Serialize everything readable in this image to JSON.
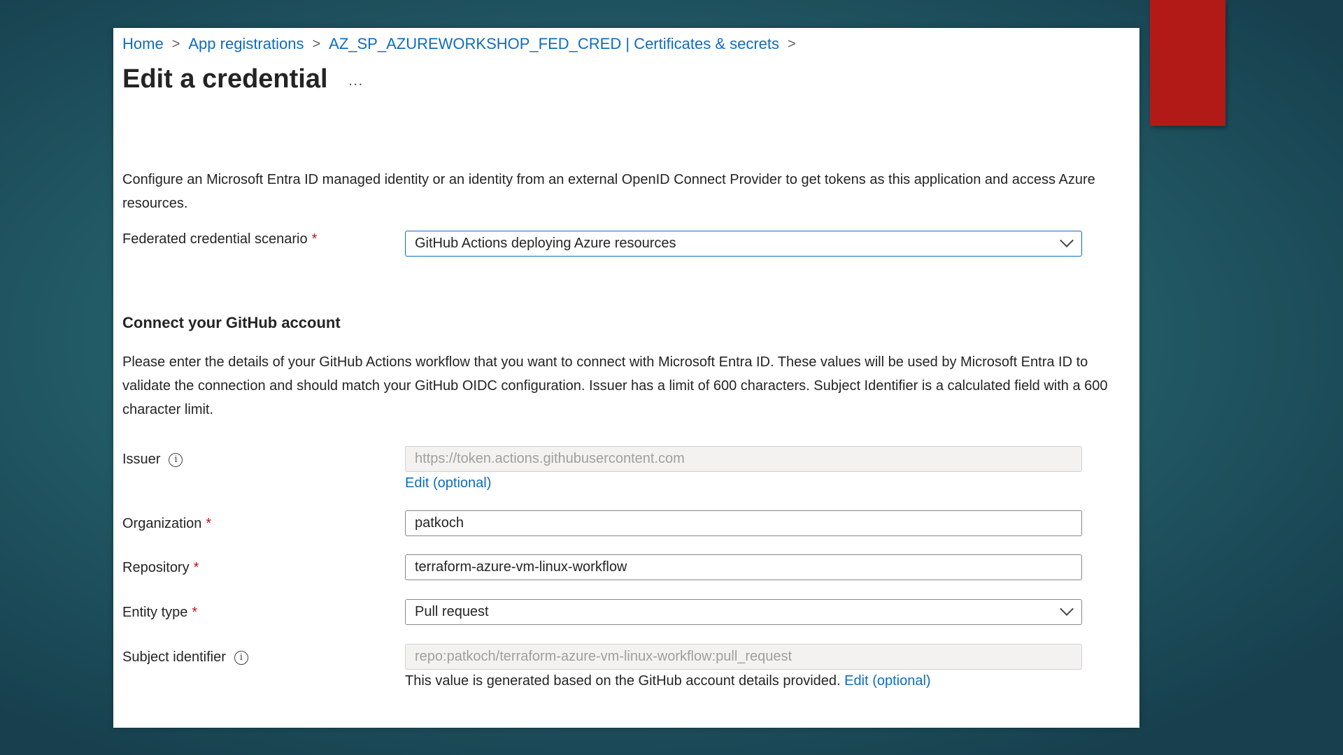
{
  "breadcrumb": {
    "home": "Home",
    "app_registrations": "App registrations",
    "app_page": "AZ_SP_AZUREWORKSHOP_FED_CRED | Certificates & secrets",
    "separator": ">"
  },
  "page": {
    "title": "Edit a credential",
    "more_label": "..."
  },
  "description": "Configure an Microsoft Entra ID managed identity or an identity from an external OpenID Connect Provider to get tokens as this application and access Azure resources.",
  "scenario": {
    "label": "Federated credential scenario",
    "required_mark": "*",
    "value": "GitHub Actions deploying Azure resources"
  },
  "section": {
    "title": "Connect your GitHub account",
    "description": "Please enter the details of your GitHub Actions workflow that you want to connect with Microsoft Entra ID. These values will be used by Microsoft Entra ID to validate the connection and should match your GitHub OIDC configuration. Issuer has a limit of 600 characters. Subject Identifier is a calculated field with a 600 character limit."
  },
  "issuer": {
    "label": "Issuer",
    "info_icon": "i",
    "value": "https://token.actions.githubusercontent.com",
    "edit_link": "Edit (optional)"
  },
  "organization": {
    "label": "Organization",
    "required_mark": "*",
    "value": "patkoch"
  },
  "repository": {
    "label": "Repository",
    "required_mark": "*",
    "value": "terraform-azure-vm-linux-workflow"
  },
  "entity_type": {
    "label": "Entity type",
    "required_mark": "*",
    "value": "Pull request"
  },
  "subject": {
    "label": "Subject identifier",
    "info_icon": "i",
    "value": "repo:patkoch/terraform-azure-vm-linux-workflow:pull_request",
    "helper_text": "This value is generated based on the GitHub account details provided.",
    "edit_link": "Edit (optional)"
  },
  "colors": {
    "link": "#0f6cbd",
    "required": "#c50f1f",
    "accent_tab": "#b21a17"
  }
}
